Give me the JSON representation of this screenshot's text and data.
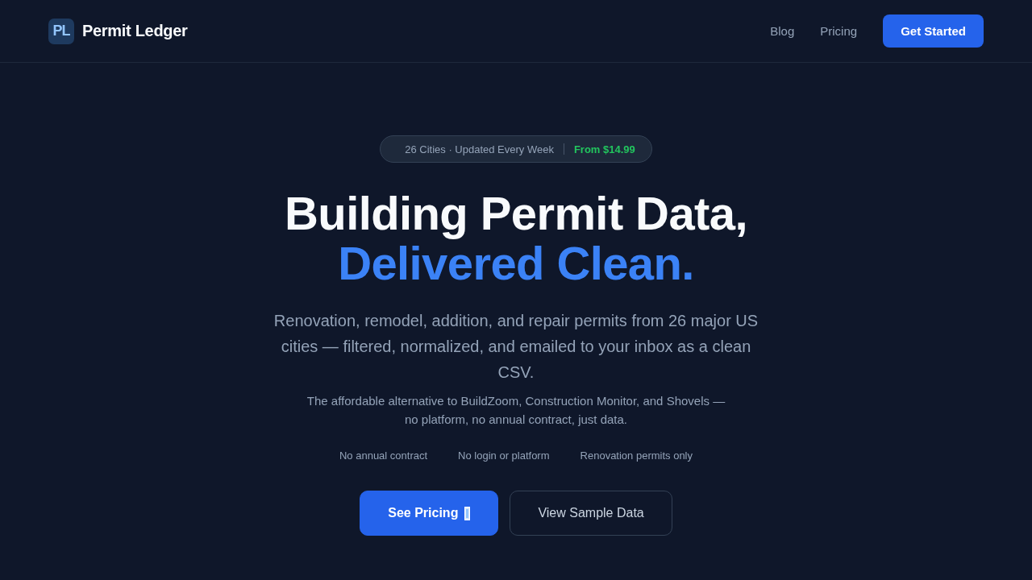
{
  "header": {
    "logo_mark": "PL",
    "brand": "Permit Ledger",
    "nav": [
      "Blog",
      "Pricing"
    ],
    "cta": "Get Started"
  },
  "hero": {
    "badge": {
      "text": "26 Cities · Updated Every Week",
      "price": "From $14.99"
    },
    "headline": {
      "line_1": "Building Permit Data,",
      "line_2": "Delivered Clean."
    },
    "lead": "Renovation, remodel, addition, and repair permits from 26 major US cities — filtered, normalized, and emailed to your inbox as a clean CSV.",
    "sublead": "The affordable alternative to BuildZoom, Construction Monitor, and Shovels — no platform, no annual contract, just data.",
    "features": [
      "No annual contract",
      "No login or platform",
      "Renovation permits only"
    ],
    "actions": [
      {
        "label": "See Pricing",
        "kind": "primary"
      },
      {
        "label": "View Sample Data",
        "kind": "secondary"
      }
    ]
  }
}
